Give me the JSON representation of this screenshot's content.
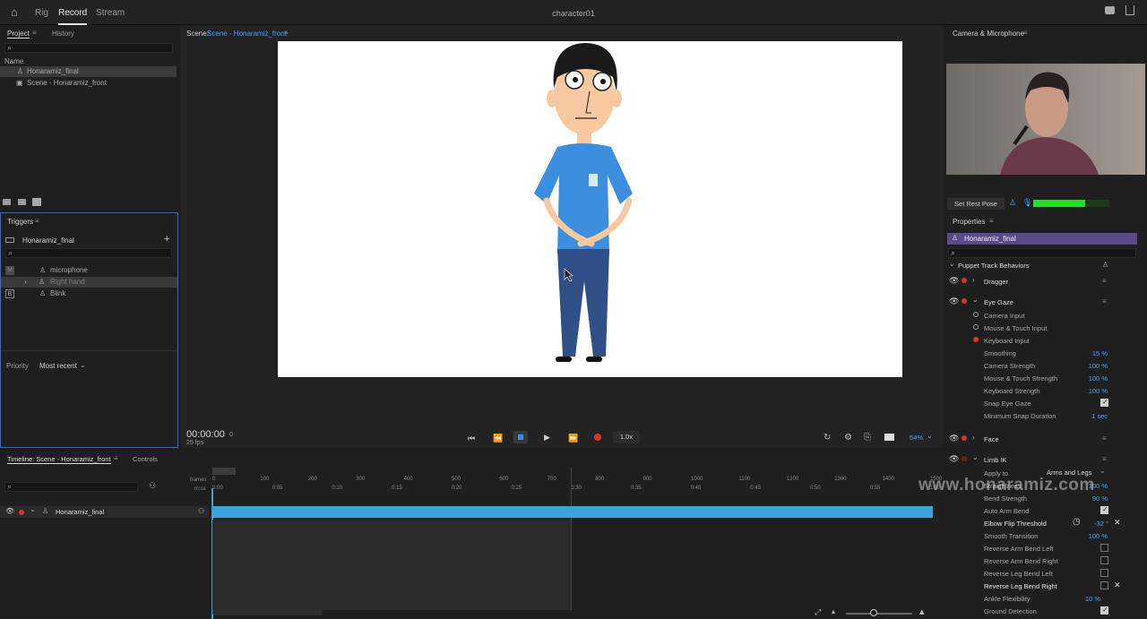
{
  "top": {
    "tabs": [
      "Rig",
      "Record",
      "Stream"
    ],
    "title": "character01"
  },
  "project": {
    "tabs": [
      "Project",
      "History"
    ],
    "name_header": "Name",
    "items": [
      "Honaramiz_final",
      "Scene - Honaramiz_front"
    ]
  },
  "triggers": {
    "title": "Triggers",
    "puppet": "Honaramiz_final",
    "items": [
      {
        "key": "M",
        "label": "microphone"
      },
      {
        "key": "",
        "label": "Right hand"
      },
      {
        "key": "B",
        "label": "Blink"
      }
    ],
    "priority_label": "Priority",
    "priority_value": "Most recent"
  },
  "scene": {
    "label": "Scene:",
    "name": "Scene - Honaramiz_front"
  },
  "transport": {
    "time": "00:00:00",
    "frame": "0",
    "fps": "25 fps",
    "speed": "1.0x",
    "zoom": "54%"
  },
  "camera": {
    "title": "Camera & Microphone",
    "set_rest_pose": "Set Rest Pose",
    "mic_level": 0.68
  },
  "properties": {
    "title": "Properties",
    "puppet": "Honaramiz_final",
    "section": "Puppet Track Behaviors",
    "behaviors": [
      "Dragger",
      "Eye Gaze",
      "Face",
      "Limb IK"
    ],
    "eye_gaze": {
      "inputs": [
        "Camera Input",
        "Mouse & Touch Input",
        "Keyboard Input"
      ],
      "smoothing_label": "Smoothing",
      "smoothing": "15 %",
      "camera_strength_label": "Camera Strength",
      "camera_strength": "100 %",
      "mouse_strength_label": "Mouse & Touch Strength",
      "mouse_strength": "100 %",
      "keyboard_strength_label": "Keyboard Strength",
      "keyboard_strength": "100 %",
      "snap_label": "Snap Eye Gaze",
      "min_snap_label": "Minimum Snap Duration",
      "min_snap": "1 sec"
    },
    "limb_ik": {
      "apply_to_label": "Apply to",
      "apply_to": "Arms and Legs",
      "straightness_label": "Straightness",
      "straightness": "100 %",
      "bend_strength_label": "Bend Strength",
      "bend_strength": "90 %",
      "auto_arm_bend_label": "Auto Arm Bend",
      "elbow_flip_label": "Elbow Flip Threshold",
      "elbow_flip": "-32 °",
      "smooth_transition_label": "Smooth Transition",
      "smooth_transition": "100 %",
      "rev_arm_left": "Reverse Arm Bend Left",
      "rev_arm_right": "Reverse Arm Bend Right",
      "rev_leg_left": "Reverse Leg Bend Left",
      "rev_leg_right": "Reverse Leg Bend Right",
      "ankle_flex_label": "Ankle Flexibility",
      "ankle_flex": "10 %",
      "ground_label": "Ground Detection"
    }
  },
  "timeline": {
    "tabs": [
      "Timeline: Scene - Honaramiz_front",
      "Controls"
    ],
    "frames_label": "frames",
    "ms_label": "m:ss",
    "frame_ticks": [
      "0",
      "100",
      "200",
      "300",
      "400",
      "500",
      "600",
      "700",
      "800",
      "900",
      "1000",
      "1100",
      "1200",
      "1300",
      "1400",
      "1500"
    ],
    "time_ticks": [
      "0:00",
      "0:05",
      "0:10",
      "0:15",
      "0:20",
      "0:25",
      "0:30",
      "0:35",
      "0:40",
      "0:45",
      "0:50",
      "0:55",
      "1:00"
    ],
    "track": "Honaramiz_final"
  },
  "watermark": "www.honaramiz.com",
  "colors": {
    "accent": "#3aa3dc",
    "record": "#e0302a",
    "link": "#4aa0ff"
  }
}
